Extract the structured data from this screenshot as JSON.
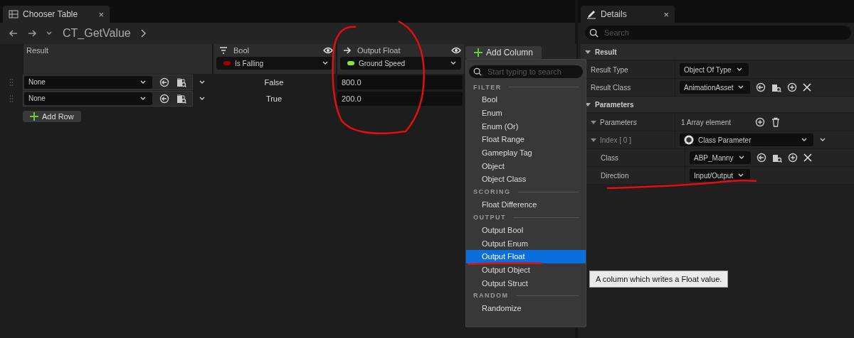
{
  "editor_tab": {
    "title": "Chooser Table",
    "close": "×"
  },
  "breadcrumb": {
    "asset": "CT_GetValue"
  },
  "table": {
    "columns": [
      {
        "kind": "result",
        "title": "Result"
      },
      {
        "kind": "bool",
        "title": "Bool",
        "binding": "Is Falling",
        "color": "#a00000"
      },
      {
        "kind": "output",
        "title": "Output Float",
        "binding": "Ground Speed",
        "color": "#8fe03c"
      }
    ],
    "add_column": "Add Column",
    "rows": [
      {
        "result": "None",
        "bool": "False",
        "output": "800.0"
      },
      {
        "result": "None",
        "bool": "True",
        "output": "200.0"
      }
    ],
    "add_row": "Add Row"
  },
  "column_menu": {
    "placeholder": "Start typing to search",
    "sections": [
      {
        "title": "FILTER",
        "items": [
          {
            "label": "Bool",
            "selected": false
          },
          {
            "label": "Enum",
            "selected": false
          },
          {
            "label": "Enum (Or)",
            "selected": false
          },
          {
            "label": "Float Range",
            "selected": false
          },
          {
            "label": "Gameplay Tag",
            "selected": false
          },
          {
            "label": "Object",
            "selected": false
          },
          {
            "label": "Object Class",
            "selected": false
          }
        ]
      },
      {
        "title": "SCORING",
        "items": [
          {
            "label": "Float Difference",
            "selected": false
          }
        ]
      },
      {
        "title": "OUTPUT",
        "items": [
          {
            "label": "Output Bool",
            "selected": false
          },
          {
            "label": "Output Enum",
            "selected": false
          },
          {
            "label": "Output Float",
            "selected": true
          },
          {
            "label": "Output Object",
            "selected": false
          },
          {
            "label": "Output Struct",
            "selected": false
          }
        ]
      },
      {
        "title": "RANDOM",
        "items": [
          {
            "label": "Randomize",
            "selected": false
          }
        ]
      }
    ],
    "tooltip": "A column which writes a Float value."
  },
  "details": {
    "title": "Details",
    "close": "×",
    "placeholder": "Search",
    "sections": [
      {
        "title": "Result",
        "expanded": true,
        "rows": [
          {
            "kind": "combo",
            "label": "Result Type",
            "value": "Object Of Type"
          },
          {
            "kind": "asset",
            "label": "Result Class",
            "value": "AnimationAsset"
          }
        ]
      },
      {
        "title": "Parameters",
        "expanded": true,
        "rows": [
          {
            "kind": "array",
            "label": "Parameters",
            "value": "1 Array element",
            "expanded": true
          },
          {
            "kind": "struct",
            "label": "Index [ 0 ]",
            "value": "Class Parameter",
            "expanded": true,
            "children": [
              {
                "kind": "asset",
                "label": "Class",
                "value": "ABP_Manny"
              },
              {
                "kind": "combo",
                "label": "Direction",
                "value": "Input/Output"
              }
            ]
          }
        ]
      }
    ]
  }
}
